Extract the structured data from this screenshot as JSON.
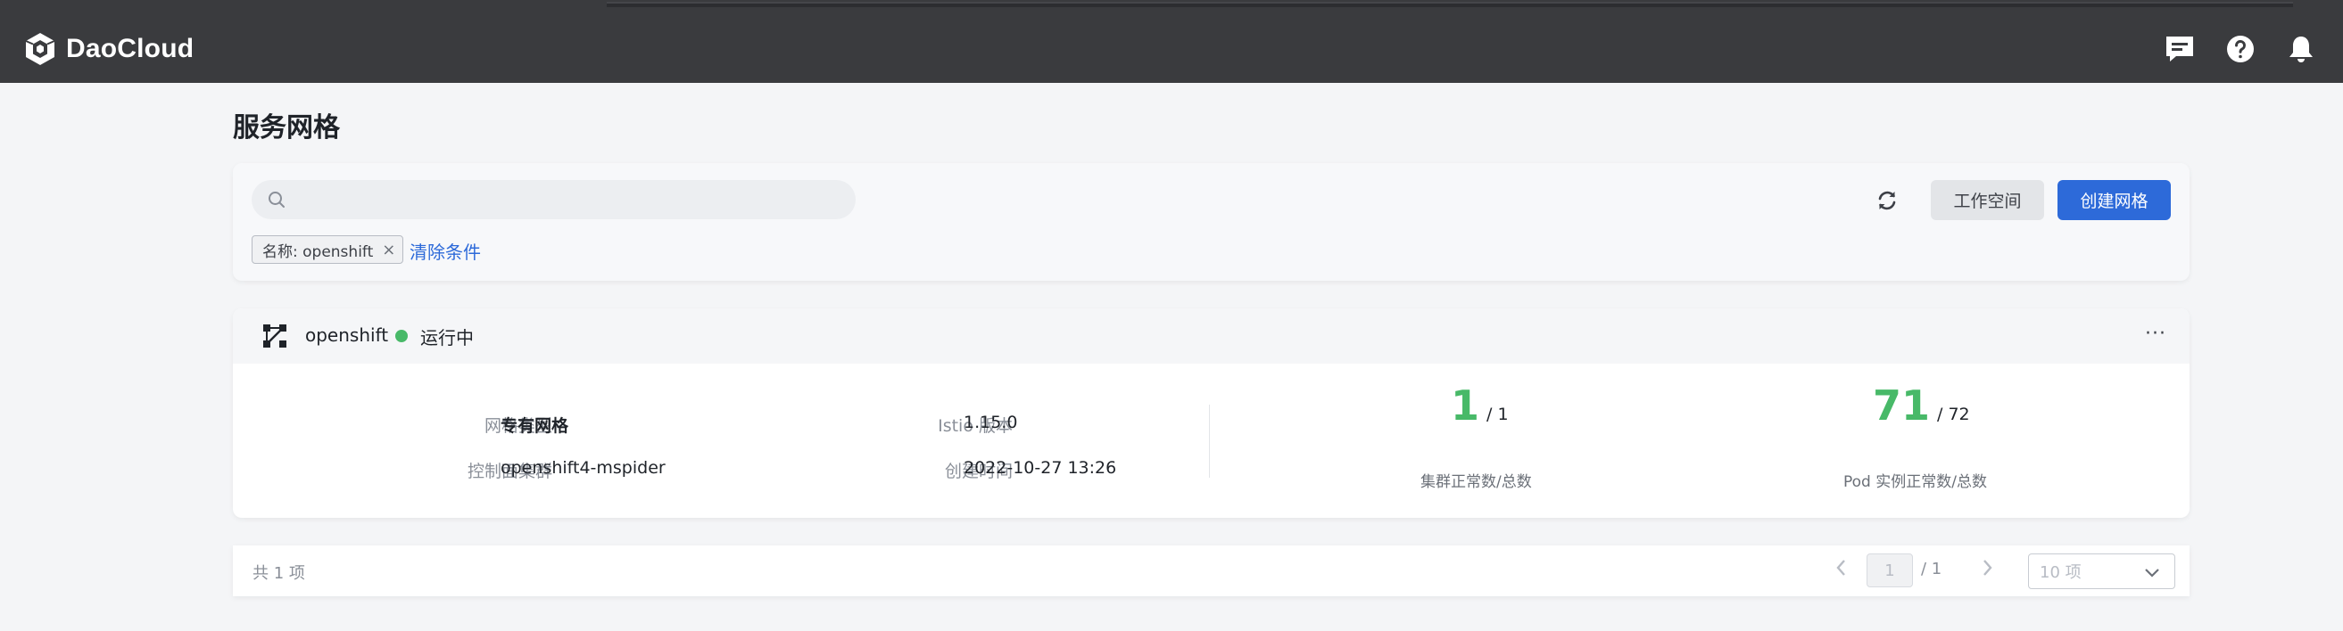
{
  "app": {
    "brand": "DaoCloud"
  },
  "topbar": {
    "icons": [
      {
        "name": "message-icon"
      },
      {
        "name": "help-icon"
      },
      {
        "name": "bell-icon"
      }
    ]
  },
  "page": {
    "title": "服务网格"
  },
  "filter": {
    "search_placeholder": "",
    "refresh_icon": "refresh-icon",
    "workspace_label": "工作空间",
    "create_label": "创建网格",
    "tag_label": "名称: openshift",
    "tag_close": "×",
    "clear_label": "清除条件"
  },
  "mesh": {
    "name": "openshift",
    "status": "运行中",
    "status_color": "#48b968",
    "more": "···",
    "type_label": "网格类型",
    "type_value": "专有网格",
    "cluster_label": "控制面集群",
    "cluster_value": "openshift4-mspider",
    "istio_label": "Istio 版本",
    "istio_value": "1.15.0",
    "created_label": "创建时间",
    "created_value": "2022-10-27 13:26",
    "clusters_ok": "1",
    "clusters_total": "/ 1",
    "clusters_label": "集群正常数/总数",
    "pods_ok": "71",
    "pods_total": "/ 72",
    "pods_label": "Pod 实例正常数/总数"
  },
  "pagination": {
    "total": "共 1 项",
    "current": "1",
    "of": "/ 1",
    "page_size": "10 项"
  },
  "colors": {
    "topbar": "#3a3b3e",
    "primary": "#2d6ad9",
    "success": "#48b968"
  }
}
